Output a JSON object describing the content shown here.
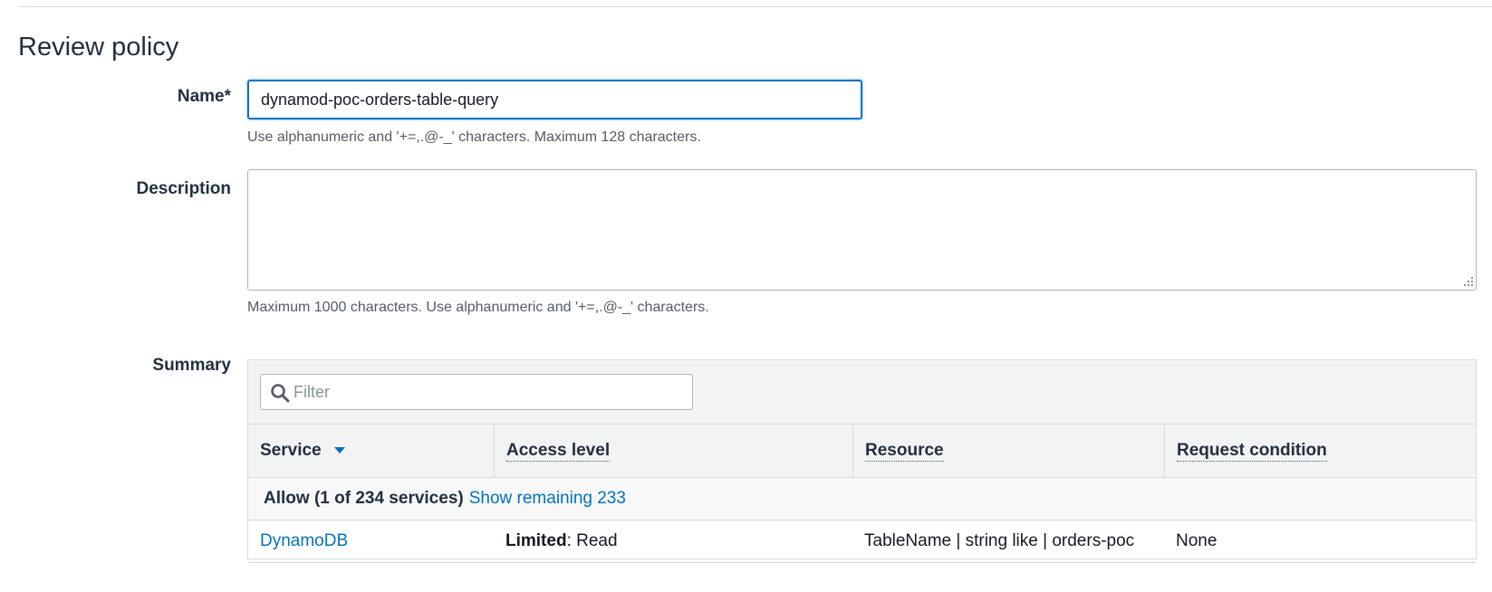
{
  "page": {
    "title": "Review policy"
  },
  "name_field": {
    "label": "Name*",
    "value": "dynamod-poc-orders-table-query",
    "hint": "Use alphanumeric and '+=,.@-_' characters. Maximum 128 characters."
  },
  "description_field": {
    "label": "Description",
    "value": "",
    "hint": "Maximum 1000 characters. Use alphanumeric and '+=,.@-_' characters."
  },
  "summary": {
    "label": "Summary",
    "filter_placeholder": "Filter",
    "columns": {
      "service": "Service",
      "access_level": "Access level",
      "resource": "Resource",
      "request_condition": "Request condition"
    },
    "group": {
      "title": "Allow (1 of 234 services)",
      "show_remaining": "Show remaining 233"
    },
    "rows": [
      {
        "service": "DynamoDB",
        "access_level_strong": "Limited",
        "access_level_rest": ": Read",
        "resource": "TableName | string like | orders-poc",
        "request_condition": "None"
      }
    ]
  },
  "colors": {
    "link": "#0073bb",
    "focus_border": "#0073bb",
    "header_bg": "#f2f3f3"
  }
}
